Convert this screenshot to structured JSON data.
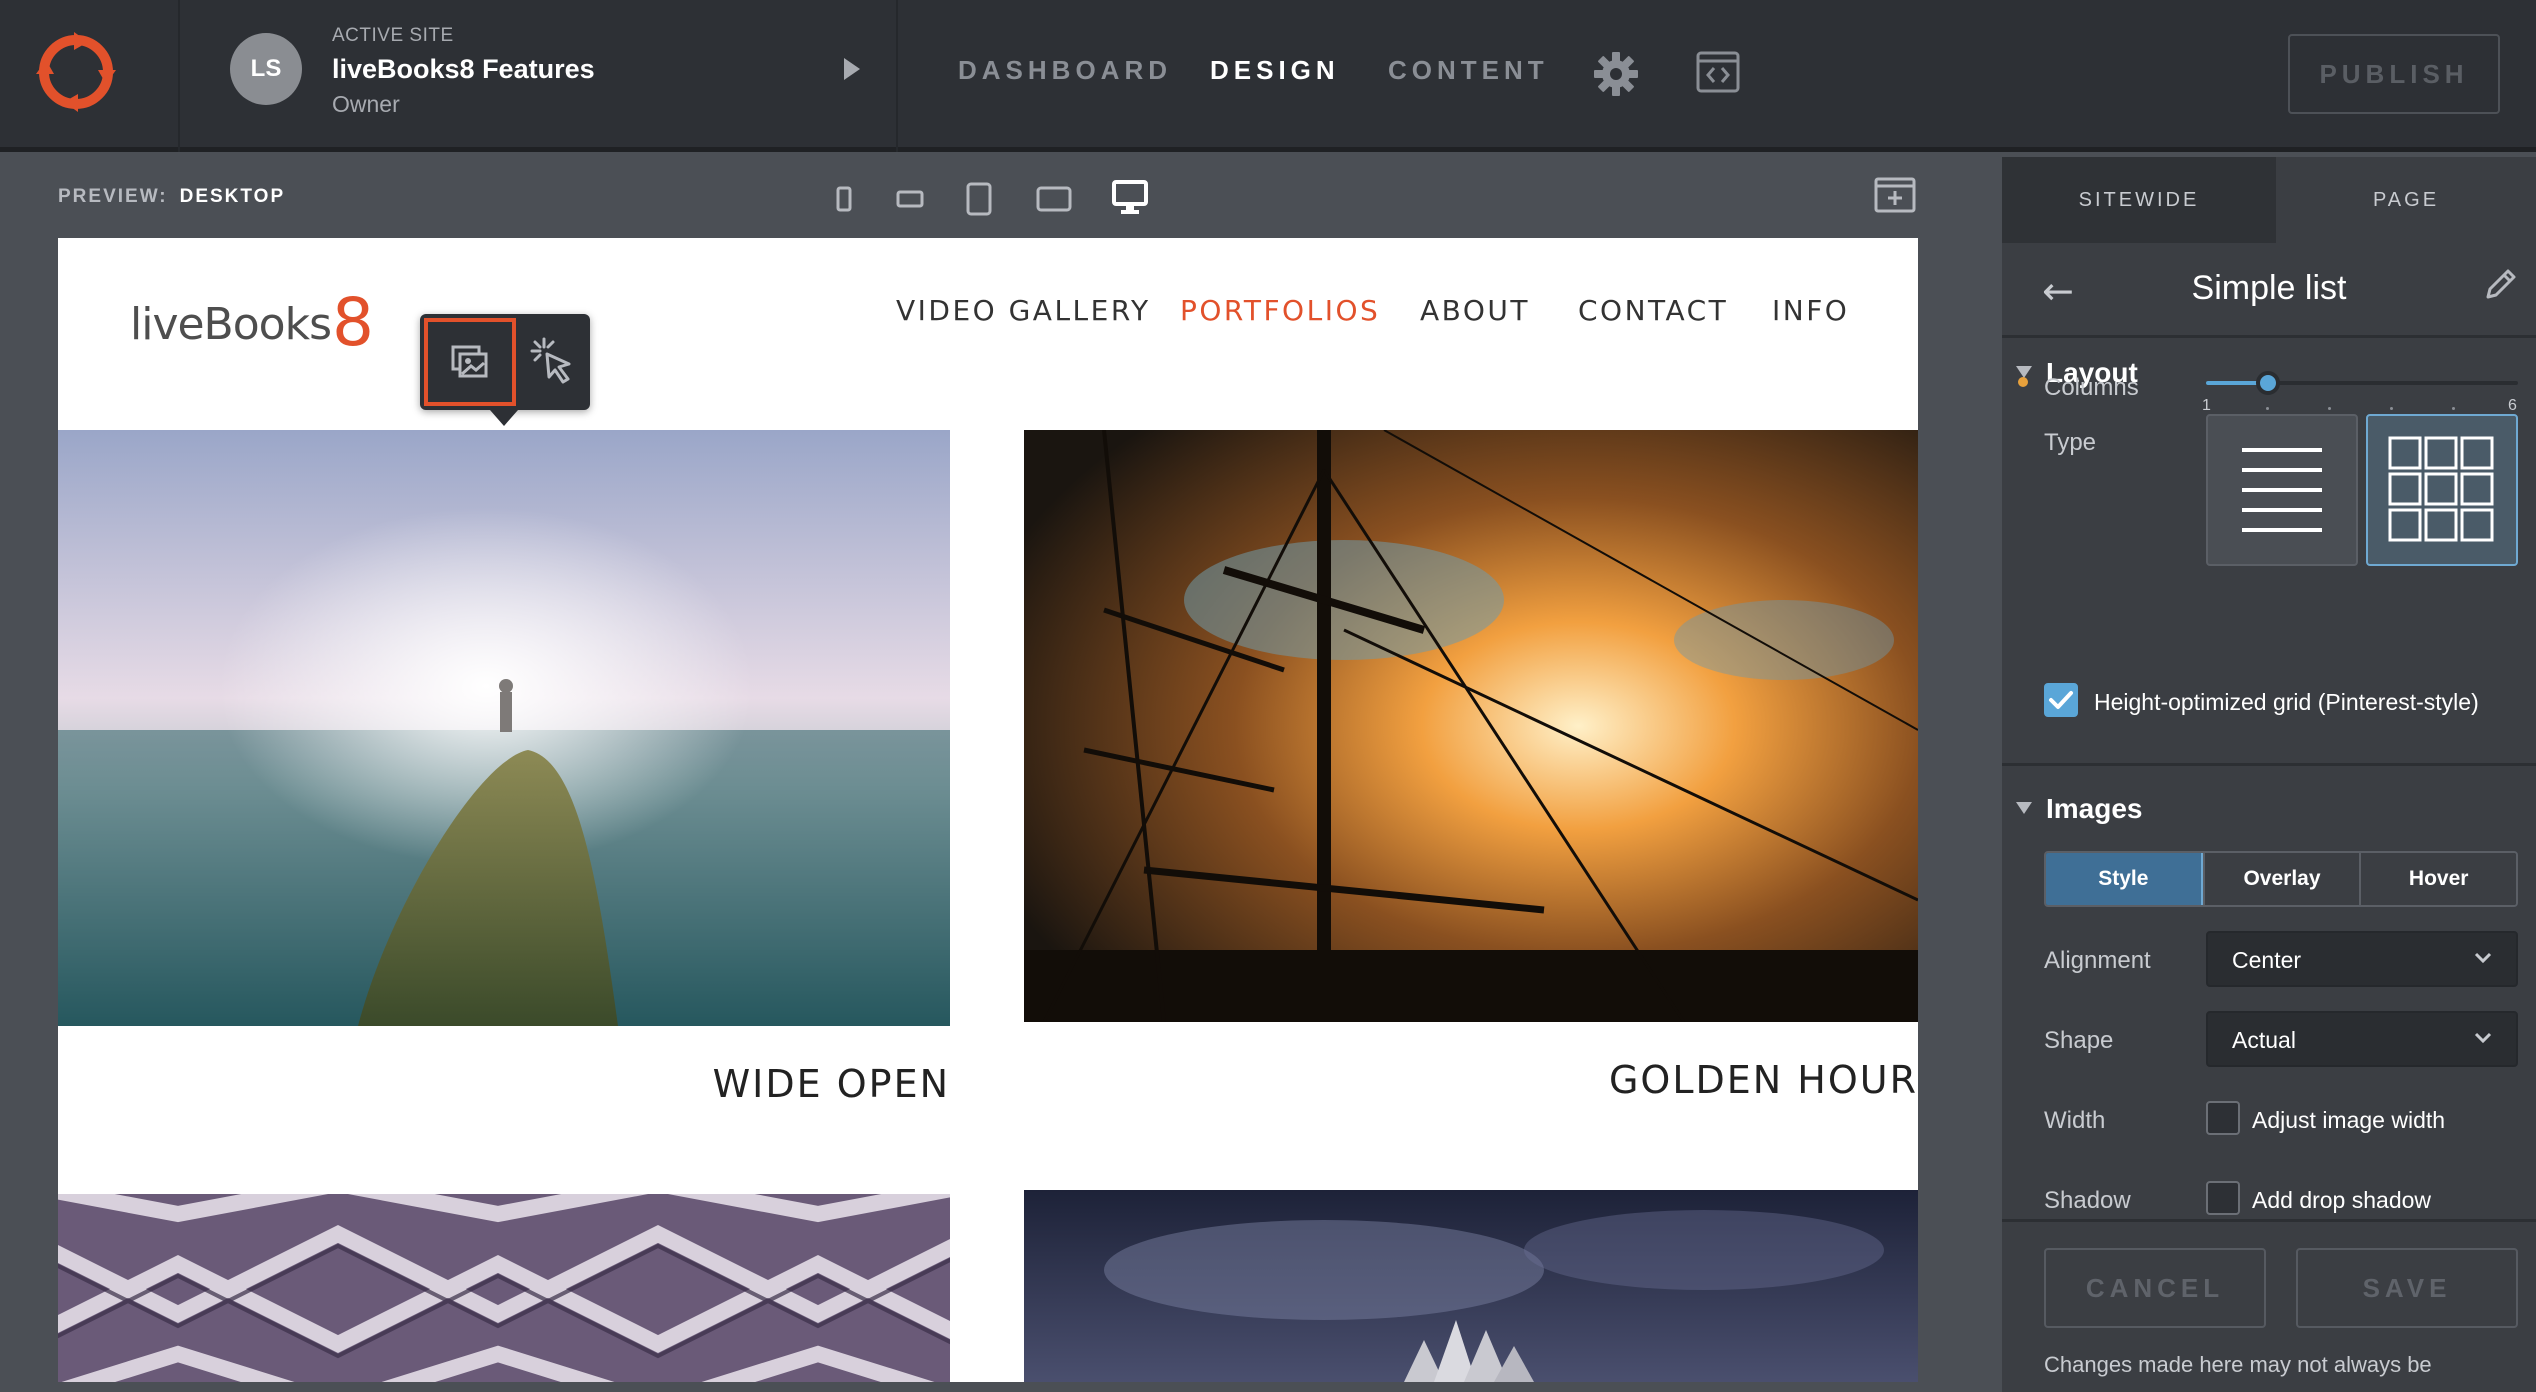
{
  "colors": {
    "accent": "#e2512b",
    "selection_blue": "#5aa6d8",
    "topbar_bg": "#2d3035",
    "panel_bg": "#3b3e43"
  },
  "header": {
    "active_site_caption": "ACTIVE SITE",
    "site_name": "liveBooks8 Features",
    "site_role": "Owner",
    "avatar_initials": "LS",
    "nav": [
      "DASHBOARD",
      "DESIGN",
      "CONTENT"
    ],
    "active_nav": "DESIGN",
    "publish_label": "PUBLISH"
  },
  "preview": {
    "label": "PREVIEW:",
    "mode": "DESKTOP",
    "devices": [
      "phone-portrait-icon",
      "phone-landscape-icon",
      "tablet-portrait-icon",
      "tablet-landscape-icon",
      "desktop-icon"
    ]
  },
  "site": {
    "brand_text": "liveBooks",
    "brand_number": "8",
    "nav": [
      "VIDEO GALLERY",
      "PORTFOLIOS",
      "ABOUT",
      "CONTACT",
      "INFO"
    ],
    "current_nav": "PORTFOLIOS",
    "captions": [
      "WIDE OPEN",
      "GOLDEN HOUR"
    ]
  },
  "panel": {
    "tabs": [
      "SITEWIDE",
      "PAGE"
    ],
    "title": "Simple list",
    "layout": {
      "heading": "Layout",
      "type_label": "Type",
      "type_options": [
        "list-layout-icon",
        "grid-layout-icon"
      ],
      "selected_type": "grid",
      "columns_label": "Columns",
      "columns_min": "1",
      "columns_max": "6",
      "columns_value": 2,
      "height_optimized_label": "Height-optimized grid (Pinterest-style)",
      "height_optimized_checked": true
    },
    "images": {
      "heading": "Images",
      "tabs": [
        "Style",
        "Overlay",
        "Hover"
      ],
      "active_tab": "Style",
      "alignment_label": "Alignment",
      "alignment_value": "Center",
      "shape_label": "Shape",
      "shape_value": "Actual",
      "width_label": "Width",
      "width_check_label": "Adjust image width",
      "shadow_label": "Shadow",
      "shadow_check_label": "Add drop shadow"
    },
    "footer": {
      "cancel_label": "CANCEL",
      "save_label": "SAVE",
      "note": "Changes made here may not always be"
    }
  }
}
